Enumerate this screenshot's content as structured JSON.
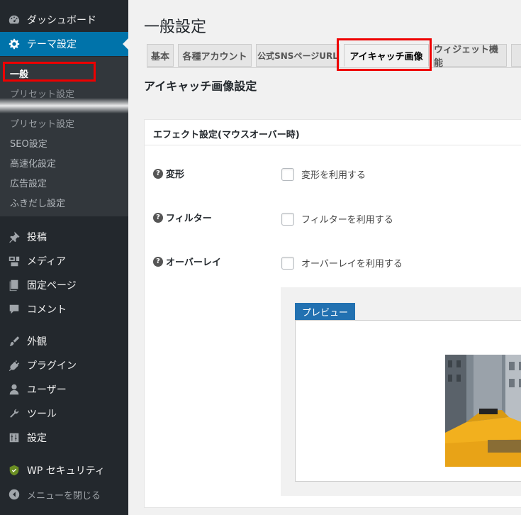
{
  "sidebar": {
    "items": {
      "dashboard": "ダッシュボード",
      "theme": "テーマ設定",
      "posts": "投稿",
      "media": "メディア",
      "pages": "固定ページ",
      "comments": "コメント",
      "appearance": "外観",
      "plugins": "プラグイン",
      "users": "ユーザー",
      "tools": "ツール",
      "settings": "設定",
      "wpsecurity": "WP セキュリティ",
      "collapse": "メニューを閉じる"
    },
    "submenu": {
      "general": "一般",
      "preset_faded": "プリセット設定",
      "preset": "プリセット設定",
      "seo": "SEO設定",
      "speed": "高速化設定",
      "ads": "広告設定",
      "balloon": "ふきだし設定"
    }
  },
  "page": {
    "title": "一般設定",
    "tabs": [
      "基本",
      "各種アカウント",
      "公式SNSページURL",
      "アイキャッチ画像",
      "ウィジェット機能"
    ],
    "section_title": "アイキャッチ画像設定",
    "panel_header": "エフェクト設定(マウスオーバー時)",
    "rows": [
      {
        "label": "変形",
        "check_label": "変形を利用する"
      },
      {
        "label": "フィルター",
        "check_label": "フィルターを利用する"
      },
      {
        "label": "オーバーレイ",
        "check_label": "オーバーレイを利用する"
      }
    ],
    "preview_label": "プレビュー",
    "help_glyph": "?"
  },
  "colors": {
    "sidebar_bg": "#23282d",
    "active": "#0073aa",
    "highlight": "#e00000",
    "preview_tab": "#2271b1"
  }
}
